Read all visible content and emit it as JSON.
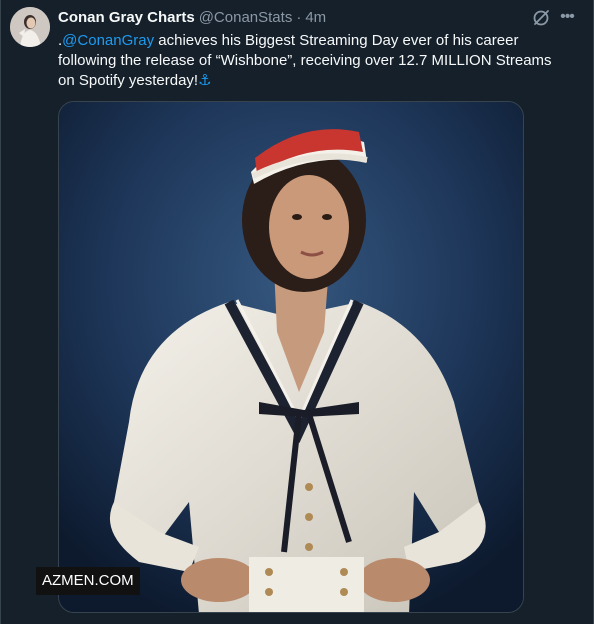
{
  "tweet": {
    "author_name": "Conan Gray Charts",
    "handle": "@ConanStats",
    "separator": "·",
    "time": "4m",
    "text_prefix": ".",
    "mention": "@ConanGray",
    "text_body": " achieves his Biggest Streaming Day ever of his career following the release of “Wishbone”, receiving over 12.7 MILLION Streams on Spotify yesterday!",
    "emoji": "⚓"
  },
  "icons": {
    "grok": "grok-icon",
    "more": "more-options-icon",
    "more_glyph": "•••"
  },
  "media": {
    "watermark": "AZMEN.COM"
  },
  "colors": {
    "background": "#15202b",
    "text": "#f7f9f9",
    "secondary": "#8b98a5",
    "accent": "#1d9bf0",
    "border": "#38444d"
  }
}
